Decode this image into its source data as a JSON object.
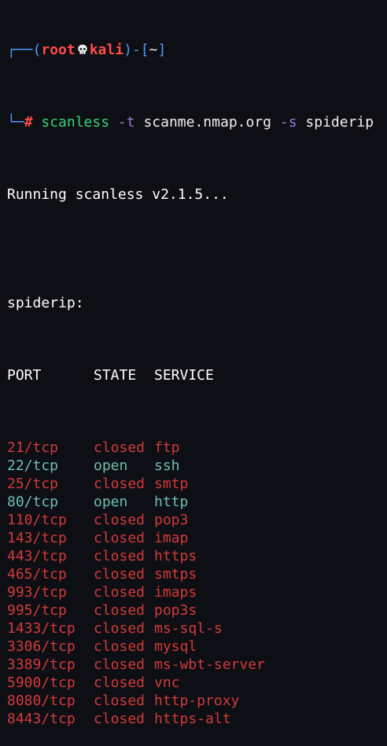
{
  "prompt": {
    "user": "root",
    "host": "kali",
    "cwd": "~",
    "symbol": "#",
    "top_left": "┌──(",
    "sep_host": ")-[",
    "end": "]",
    "bottom_left": "└─"
  },
  "command": {
    "program": "scanless",
    "flag_t": "-t",
    "target": "scanme.nmap.org",
    "flag_s": "-s",
    "scanner": "spiderip"
  },
  "output": {
    "running": "Running scanless v2.1.5...",
    "scanner_label": "spiderip:",
    "headers": {
      "port": "PORT",
      "state": "STATE",
      "service": "SERVICE"
    },
    "rows": [
      {
        "port": "21/tcp",
        "state": "closed",
        "service": "ftp"
      },
      {
        "port": "22/tcp",
        "state": "open",
        "service": "ssh"
      },
      {
        "port": "25/tcp",
        "state": "closed",
        "service": "smtp"
      },
      {
        "port": "80/tcp",
        "state": "open",
        "service": "http"
      },
      {
        "port": "110/tcp",
        "state": "closed",
        "service": "pop3"
      },
      {
        "port": "143/tcp",
        "state": "closed",
        "service": "imap"
      },
      {
        "port": "443/tcp",
        "state": "closed",
        "service": "https"
      },
      {
        "port": "465/tcp",
        "state": "closed",
        "service": "smtps"
      },
      {
        "port": "993/tcp",
        "state": "closed",
        "service": "imaps"
      },
      {
        "port": "995/tcp",
        "state": "closed",
        "service": "pop3s"
      },
      {
        "port": "1433/tcp",
        "state": "closed",
        "service": "ms-sql-s"
      },
      {
        "port": "3306/tcp",
        "state": "closed",
        "service": "mysql"
      },
      {
        "port": "3389/tcp",
        "state": "closed",
        "service": "ms-wbt-server"
      },
      {
        "port": "5900/tcp",
        "state": "closed",
        "service": "vnc"
      },
      {
        "port": "8080/tcp",
        "state": "closed",
        "service": "http-proxy"
      },
      {
        "port": "8443/tcp",
        "state": "closed",
        "service": "https-alt"
      }
    ]
  },
  "colors": {
    "background": "#0d0f14",
    "prompt_frame": "#4f9dff",
    "prompt_user": "#ff4b4b",
    "command": "#38d27a",
    "flag": "#9e7ad8",
    "closed": "#d23a3a",
    "open": "#6fbfb0",
    "text": "#f0f0f0"
  },
  "icons": {
    "skull": "skull-icon"
  }
}
